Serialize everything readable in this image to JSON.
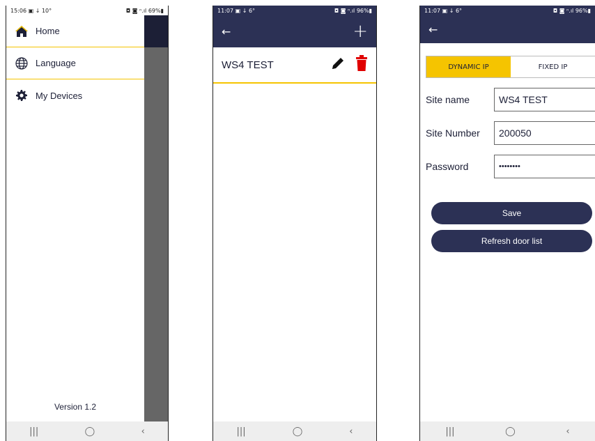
{
  "screen1": {
    "status": {
      "time": "15:06",
      "left_icons": "▣ ↓ 10°",
      "right": "◘ ◙ ⁿ.ıl 69%▮"
    },
    "menu": [
      {
        "label": "Home",
        "icon": "home-icon"
      },
      {
        "label": "Language",
        "icon": "globe-icon"
      },
      {
        "label": "My Devices",
        "icon": "gear-icon"
      }
    ],
    "version": "Version 1.2",
    "nav": {
      "recent": "|||",
      "home": "◯",
      "back": "‹"
    }
  },
  "screen2": {
    "status": {
      "time": "11:07",
      "left_icons": "▣ ↓ 6°",
      "right": "◘ ◙ ⁿ.ıl 96%▮"
    },
    "back": "←",
    "add": "+",
    "site": {
      "name": "WS4 TEST"
    },
    "nav": {
      "recent": "|||",
      "home": "◯",
      "back": "‹"
    }
  },
  "screen3": {
    "status": {
      "time": "11:07",
      "left_icons": "▣ ↓ 6°",
      "right": "◘ ◙ ⁿ.ıl 96%▮"
    },
    "back": "←",
    "toggle": {
      "dynamic": "DYNAMIC IP",
      "fixed": "FIXED IP",
      "selected": "dynamic"
    },
    "form": {
      "site_name_label": "Site name",
      "site_name_value": "WS4 TEST",
      "site_number_label": "Site Number",
      "site_number_value": "200050",
      "password_label": "Password",
      "password_value": "••••••••"
    },
    "save": "Save",
    "refresh": "Refresh door list",
    "nav": {
      "recent": "|||",
      "home": "◯",
      "back": "‹"
    }
  },
  "colors": {
    "primary": "#2c3155",
    "accent": "#f5c400",
    "delete": "#e00000",
    "overlay": "#666666"
  }
}
